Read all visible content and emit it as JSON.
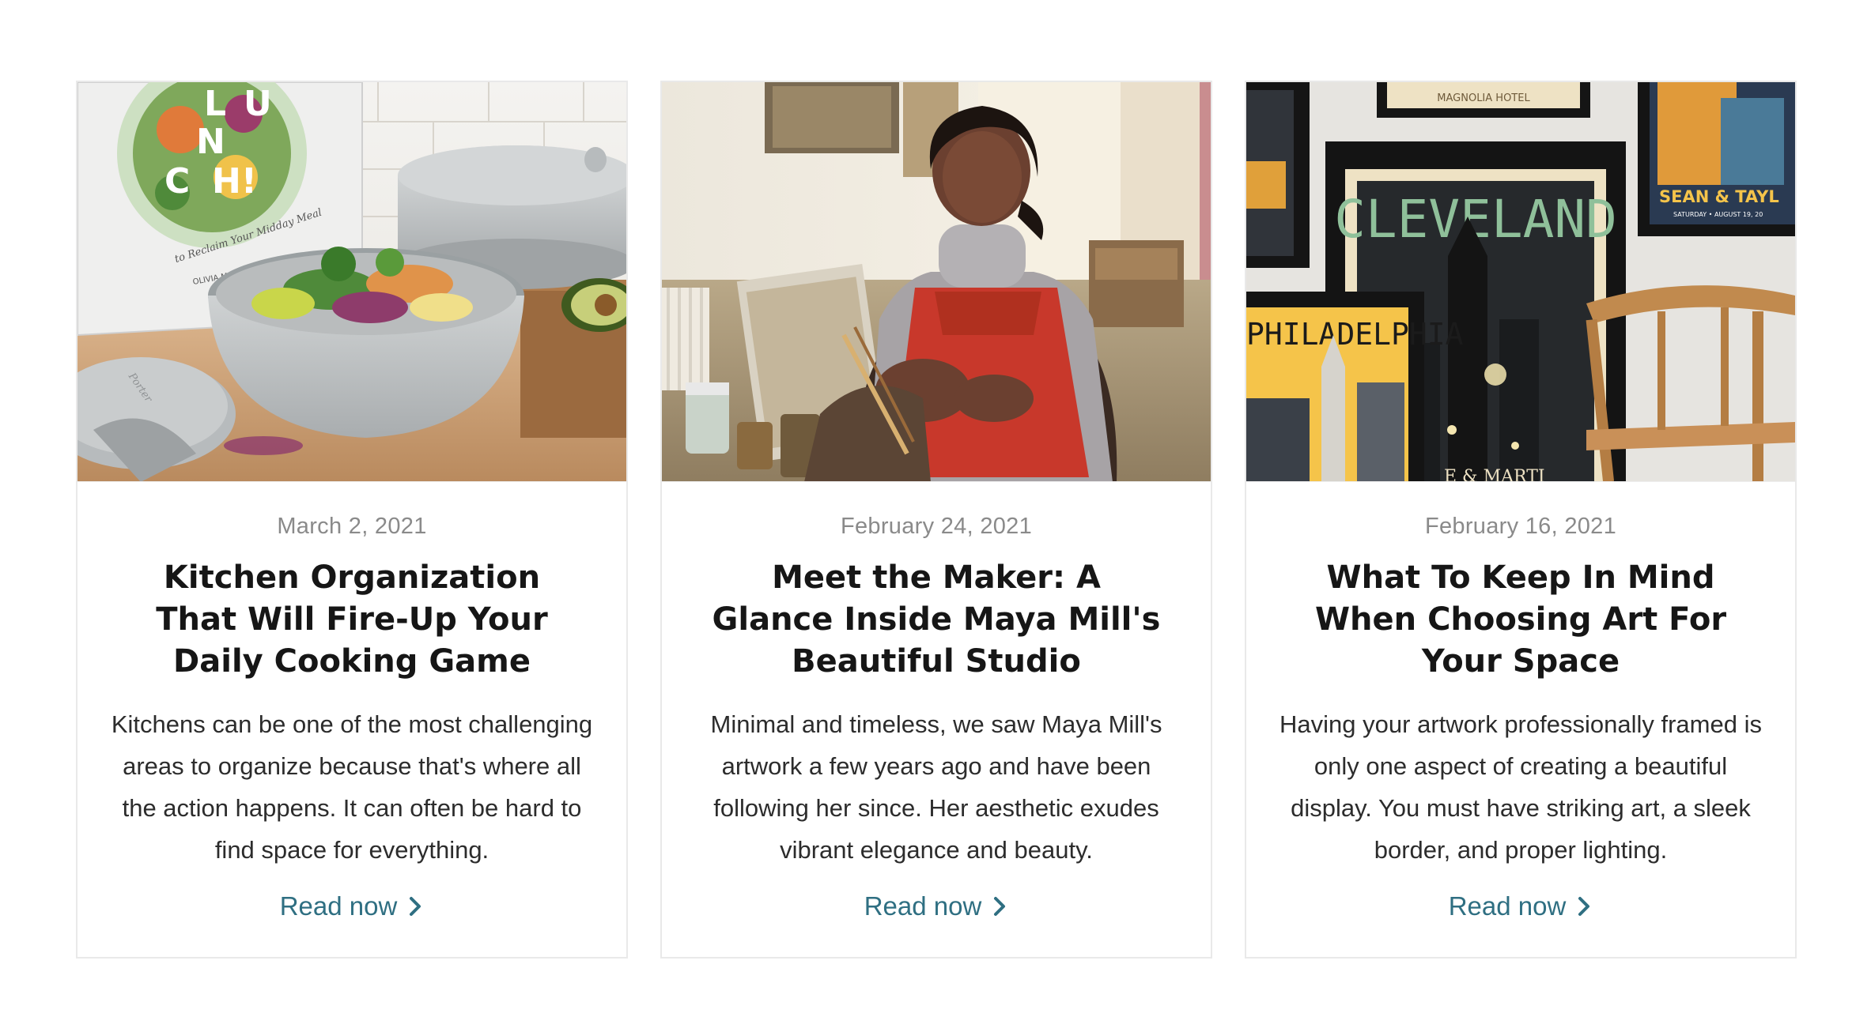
{
  "cards": [
    {
      "date": "March 2, 2021",
      "title": "Kitchen Organization That Will Fire-Up Your Daily Cooking Game",
      "excerpt": "Kitchens can be one of the most challenging areas to organize because that's where all the action happens. It can often be hard to find space for everything.",
      "link": "Read now",
      "image": {
        "cover_letters": [
          "L",
          "U",
          "N",
          "C",
          "H!"
        ],
        "cover_subtitle": "to Reclaim Your Midday Meal",
        "cover_author": "OLIVIA MACK McCOOL",
        "container_brand": "Porter"
      }
    },
    {
      "date": "February 24, 2021",
      "title": "Meet the Maker: A Glance Inside Maya Mill's Beautiful Studio",
      "excerpt": "Minimal and timeless, we saw Maya Mill's artwork a few years ago and have been following her since. Her aesthetic exudes vibrant elegance and beauty.",
      "link": "Read now",
      "image": {}
    },
    {
      "date": "February 16, 2021",
      "title": "What To Keep In Mind When Choosing Art For Your Space",
      "excerpt": "Having your artwork professionally framed is only one aspect of creating a beautiful display. You must have striking art, a sleek border, and proper lighting.",
      "link": "Read now",
      "image": {
        "poster_top": "MAGNOLIA HOTEL",
        "poster_main": "CLEVELAND",
        "poster_left": "PHILADELPHIA",
        "poster_right": "SEAN & TAYL",
        "poster_right_sub": "SATURDAY • AUGUST 19, 20",
        "poster_bottom": "E & MARTI"
      }
    }
  ],
  "colors": {
    "link": "#2f6f82",
    "date": "#8a8a8a",
    "title": "#161616",
    "border": "#e9e9e9"
  },
  "icons": {
    "link_arrow": "chevron-right-icon"
  }
}
